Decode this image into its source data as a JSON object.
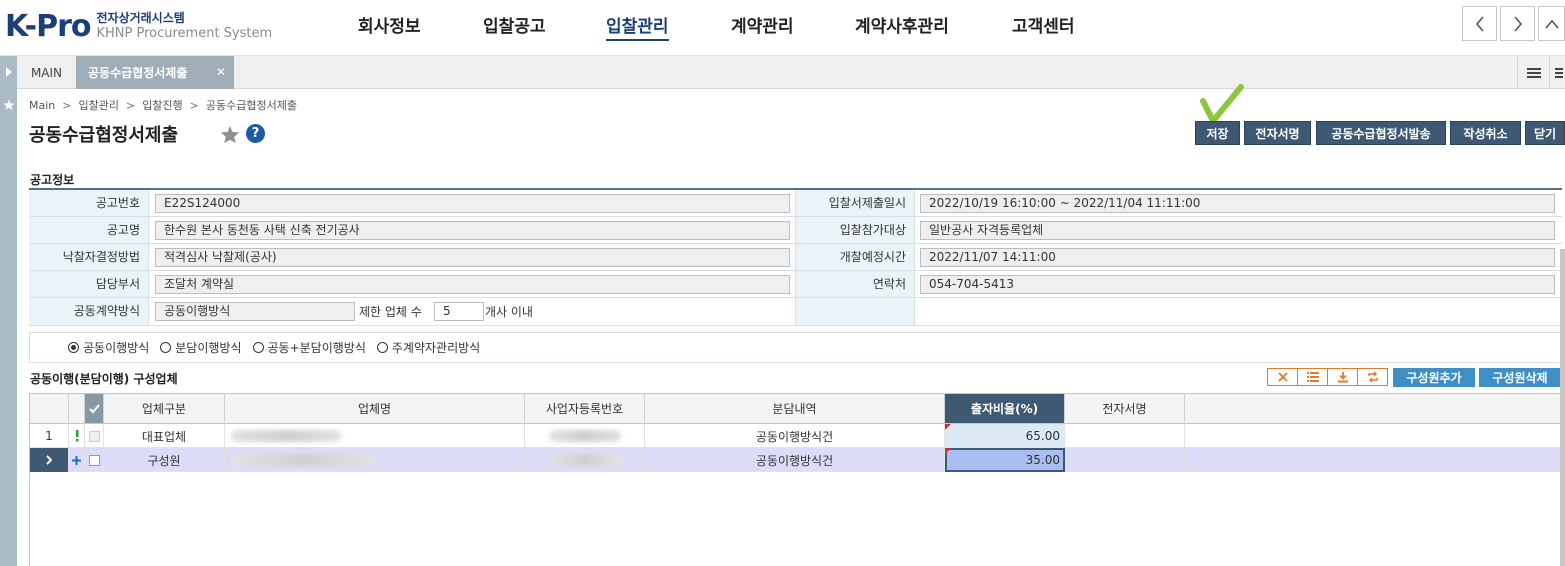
{
  "header": {
    "logo": "K-Pro",
    "logo_sub_kr": "전자상거래시스템",
    "logo_sub_en": "KHNP Procurement System",
    "nav": [
      {
        "label": "회사정보"
      },
      {
        "label": "입찰공고"
      },
      {
        "label": "입찰관리",
        "active": true
      },
      {
        "label": "계약관리"
      },
      {
        "label": "계약사후관리"
      },
      {
        "label": "고객센터"
      }
    ]
  },
  "tabs": {
    "main": "MAIN",
    "current": "공동수급협정서제출"
  },
  "breadcrumb": [
    "Main",
    "입찰관리",
    "입찰진행",
    "공동수급협정서제출"
  ],
  "page_title": "공동수급협정서제출",
  "actions": {
    "save": "저장",
    "esign": "전자서명",
    "send": "공동수급협정서발송",
    "cancel": "작성취소",
    "close": "닫기"
  },
  "notice_section": {
    "title": "공고정보",
    "labels": {
      "notice_no": "공고번호",
      "notice_name": "공고명",
      "award_method": "낙찰자결정방법",
      "dept": "담당부서",
      "joint_method": "공동계약방식",
      "bid_period": "입찰서제출일시",
      "eligibility": "입찰참가대상",
      "opening_time": "개찰예정시간",
      "contact": "연락처"
    },
    "values": {
      "notice_no": "E22S124000",
      "notice_name": "한수원 본사 동천동 사택 신축 전기공사",
      "award_method": "적격심사 낙찰제(공사)",
      "dept": "조달처 계약실",
      "joint_method": "공동이행방식",
      "limit_label": "제한 업체 수",
      "limit_value": "5",
      "limit_suffix": "개사 이내",
      "bid_period": "2022/10/19 16:10:00 ~ 2022/11/04 11:11:00",
      "eligibility": "일반공사 자격등록업체",
      "opening_time": "2022/11/07 14:11:00",
      "contact": "054-704-5413"
    }
  },
  "joint_types": [
    {
      "label": "공동이행방식",
      "selected": true
    },
    {
      "label": "분담이행방식",
      "selected": false
    },
    {
      "label": "공동+분담이행방식",
      "selected": false
    },
    {
      "label": "주계약자관리방식",
      "selected": false
    }
  ],
  "members_section": {
    "title": "공동이행(분담이행) 구성업체",
    "icons": [
      "excel-reset-icon",
      "list-icon",
      "download-icon",
      "refresh-icon"
    ],
    "add_button": "구성원추가",
    "delete_button": "구성원삭제",
    "columns": {
      "type": "업체구분",
      "name": "업체명",
      "biz_no": "사업자등록번호",
      "share": "분담내역",
      "ratio": "출자비율(%)",
      "esign": "전자서명"
    },
    "rows": [
      {
        "no": "1",
        "type": "대표업체",
        "share": "공동이행방식건",
        "ratio": "65.00"
      },
      {
        "no": "",
        "type": "구성원",
        "share": "공동이행방식건",
        "ratio": "35.00"
      }
    ]
  },
  "colors": {
    "brand": "#1d3f78",
    "action_button": "#3f5972",
    "grid_button": "#3f8fc6",
    "label_bg": "#e9f3f8",
    "selected_row": "#dcdcf8",
    "checkmark": "#8cc63f"
  }
}
